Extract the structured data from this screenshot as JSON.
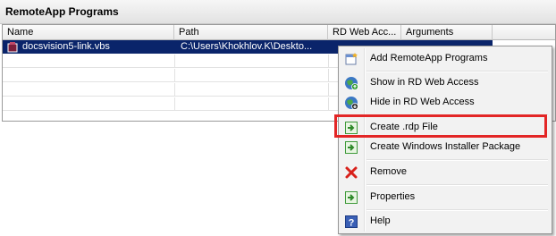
{
  "window": {
    "title": "RemoteApp Programs"
  },
  "table": {
    "columns": [
      "Name",
      "Path",
      "RD Web Acc...",
      "Arguments"
    ],
    "rows": [
      {
        "name": "docsvision5-link.vbs",
        "path": "C:\\Users\\Khokhlov.K\\Deskto...",
        "rdweb": "",
        "arguments": ""
      }
    ]
  },
  "context_menu": {
    "items": [
      {
        "label": "Add RemoteApp Programs",
        "icon": "add-remoteapp-icon"
      },
      {
        "label": "Show in RD Web Access",
        "icon": "globe-show-icon"
      },
      {
        "label": "Hide in RD Web Access",
        "icon": "globe-hide-icon"
      },
      {
        "label": "Create .rdp File",
        "icon": "create-rdp-icon"
      },
      {
        "label": "Create Windows Installer Package",
        "icon": "installer-package-icon"
      },
      {
        "label": "Remove",
        "icon": "remove-icon"
      },
      {
        "label": "Properties",
        "icon": "properties-icon"
      },
      {
        "label": "Help",
        "icon": "help-icon"
      }
    ]
  },
  "colors": {
    "selection": "#0a246a",
    "highlight_box": "#e32626"
  }
}
